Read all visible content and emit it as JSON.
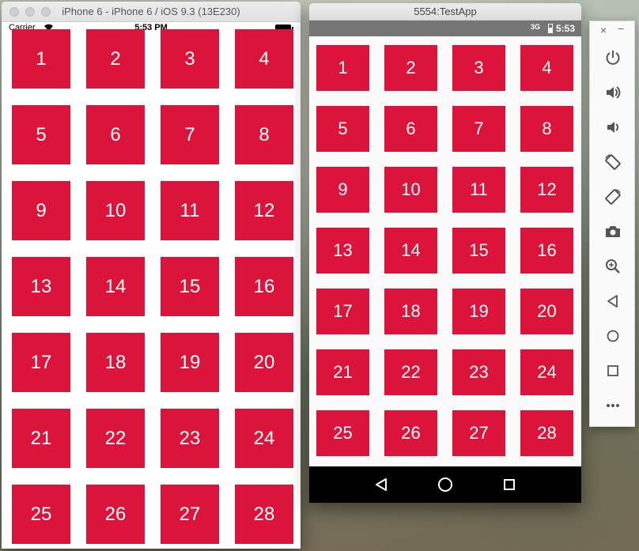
{
  "ios": {
    "window_title": "iPhone 6 - iPhone 6 / iOS 9.3 (13E230)",
    "carrier": "Carrier",
    "time": "5:53 PM",
    "tiles": [
      "1",
      "2",
      "3",
      "4",
      "5",
      "6",
      "7",
      "8",
      "9",
      "10",
      "11",
      "12",
      "13",
      "14",
      "15",
      "16",
      "17",
      "18",
      "19",
      "20",
      "21",
      "22",
      "23",
      "24",
      "25",
      "26",
      "27",
      "28"
    ]
  },
  "android": {
    "window_title": "5554:TestApp",
    "network": "3G",
    "time": "5:53",
    "tiles": [
      "1",
      "2",
      "3",
      "4",
      "5",
      "6",
      "7",
      "8",
      "9",
      "10",
      "11",
      "12",
      "13",
      "14",
      "15",
      "16",
      "17",
      "18",
      "19",
      "20",
      "21",
      "22",
      "23",
      "24",
      "25",
      "26",
      "27",
      "28"
    ]
  },
  "toolbar": {
    "close_label": "×",
    "minimize_label": "−",
    "tools": [
      "power",
      "volume-up",
      "volume-down",
      "rotate-left",
      "rotate-right",
      "camera",
      "zoom",
      "back",
      "home",
      "overview",
      "more"
    ]
  },
  "colors": {
    "tile": "#dc143c",
    "android_status": "#757575",
    "icon": "#555555"
  }
}
